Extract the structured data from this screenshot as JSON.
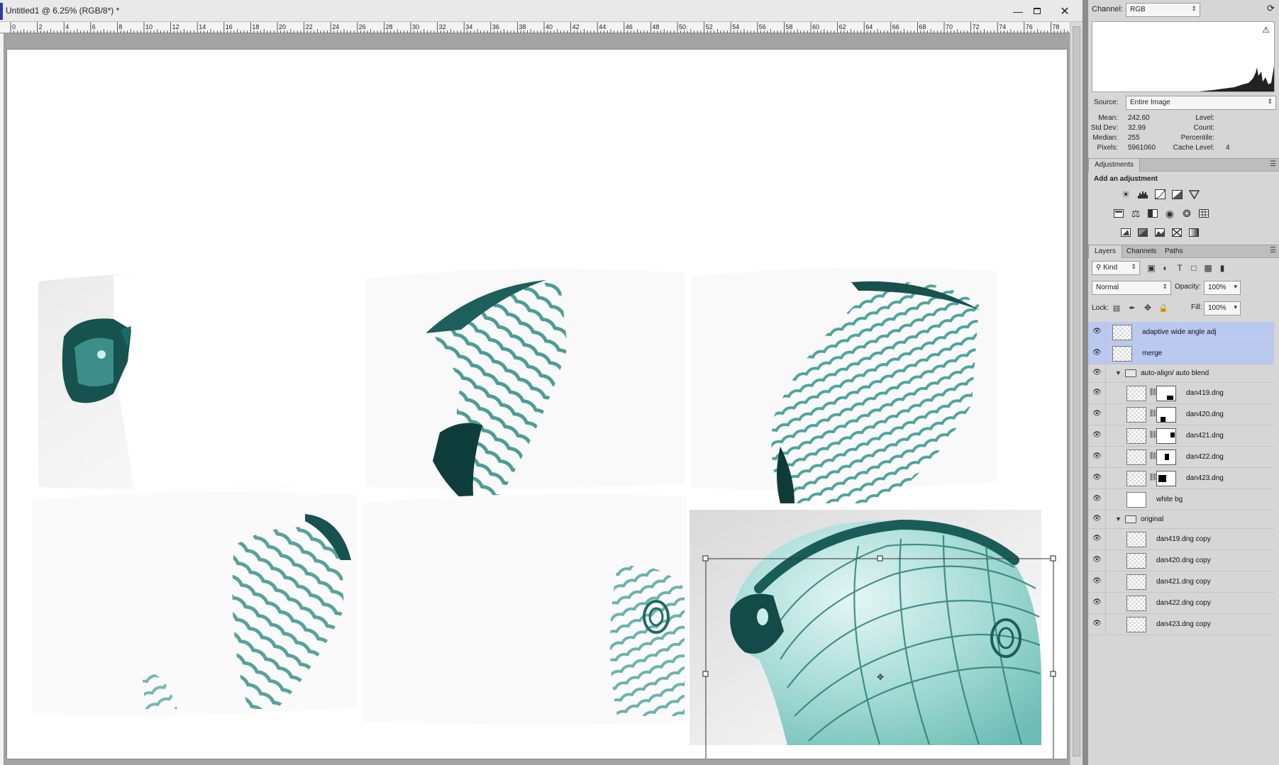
{
  "document": {
    "title": "Untitled1 @ 6.25% (RGB/8*) *",
    "minimize_icon": "minimize-icon",
    "maximize_icon": "maximize-icon",
    "close_icon": "close-icon",
    "ruler_labels": [
      "0",
      "2",
      "4",
      "6",
      "8",
      "10",
      "12",
      "14",
      "16",
      "18",
      "20",
      "22",
      "24",
      "26",
      "28",
      "30",
      "32",
      "34",
      "36",
      "38",
      "40",
      "42",
      "44",
      "46",
      "48",
      "50",
      "52",
      "54",
      "56",
      "58",
      "60",
      "62",
      "64",
      "66",
      "68",
      "70",
      "72",
      "74",
      "76",
      "78"
    ]
  },
  "histogram": {
    "channel_label": "Channel:",
    "channel_value": "RGB",
    "source_label": "Source:",
    "source_value": "Entire Image",
    "stats": {
      "mean_label": "Mean:",
      "mean": "242.60",
      "stddev_label": "Std Dev:",
      "stddev": "32.99",
      "median_label": "Median:",
      "median": "255",
      "pixels_label": "Pixels:",
      "pixels": "5961060",
      "level_label": "Level:",
      "count_label": "Count:",
      "percentile_label": "Percentile:",
      "cache_label": "Cache Level:",
      "cache": "4"
    }
  },
  "adjustments": {
    "tab": "Adjustments",
    "heading": "Add an adjustment",
    "icons": [
      "brightness-icon",
      "levels-icon",
      "curves-icon",
      "exposure-icon",
      "vibrance-icon",
      "hue-saturation-icon",
      "color-balance-icon",
      "black-white-icon",
      "photo-filter-icon",
      "channel-mixer-icon",
      "color-lookup-icon",
      "invert-icon",
      "posterize-icon",
      "threshold-icon",
      "selective-color-icon",
      "gradient-map-icon"
    ]
  },
  "layers": {
    "tabs": [
      "Layers",
      "Channels",
      "Paths"
    ],
    "kind_value": "Kind",
    "blend_mode": "Normal",
    "opacity_label": "Opacity:",
    "opacity": "100%",
    "lock_label": "Lock:",
    "fill_label": "Fill:",
    "fill": "100%",
    "items": [
      {
        "name": "adaptive wide angle adj",
        "kind": "layer",
        "selected": true,
        "indent": 0
      },
      {
        "name": "merge",
        "kind": "layer",
        "selected": true,
        "indent": 0
      },
      {
        "name": "auto-align/ auto blend",
        "kind": "group",
        "selected": false,
        "indent": 0
      },
      {
        "name": "dan419.dng",
        "kind": "masked",
        "selected": false,
        "indent": 1
      },
      {
        "name": "dan420.dng",
        "kind": "masked",
        "selected": false,
        "indent": 1
      },
      {
        "name": "dan421.dng",
        "kind": "masked",
        "selected": false,
        "indent": 1
      },
      {
        "name": "dan422.dng",
        "kind": "masked",
        "selected": false,
        "indent": 1
      },
      {
        "name": "dan423.dng",
        "kind": "masked",
        "selected": false,
        "indent": 1
      },
      {
        "name": "white bg",
        "kind": "white",
        "selected": false,
        "indent": 1
      },
      {
        "name": "original",
        "kind": "group",
        "selected": false,
        "indent": 0
      },
      {
        "name": "dan419.dng copy",
        "kind": "layer",
        "selected": false,
        "indent": 1
      },
      {
        "name": "dan420.dng copy",
        "kind": "layer",
        "selected": false,
        "indent": 1
      },
      {
        "name": "dan421.dng copy",
        "kind": "layer",
        "selected": false,
        "indent": 1
      },
      {
        "name": "dan422.dng copy",
        "kind": "layer",
        "selected": false,
        "indent": 1
      },
      {
        "name": "dan423.dng copy",
        "kind": "layer",
        "selected": false,
        "indent": 1
      }
    ]
  },
  "colors": {
    "glass_teal": "#1f7d78",
    "glass_light": "#a8ddd8",
    "selection_blue": "#b9c9ef"
  }
}
